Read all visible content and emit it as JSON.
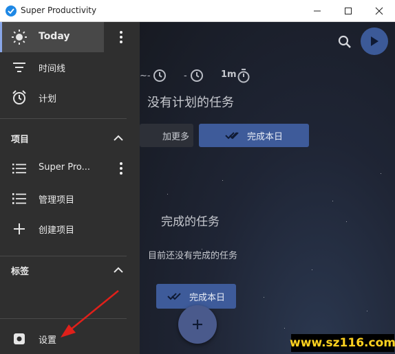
{
  "window": {
    "title": "Super Productivity"
  },
  "sidebar": {
    "today_label": "Today",
    "timeline_label": "时间线",
    "plan_label": "计划",
    "projects_header": "项目",
    "project_item_label": "Super Pro...",
    "manage_projects_label": "管理项目",
    "create_project_label": "创建项目",
    "tags_header": "标签",
    "settings_label": "设置"
  },
  "main": {
    "estimate_badge": "1m",
    "no_planned_tasks": "没有计划的任务",
    "add_more_label": "加更多",
    "finish_day_label": "完成本日",
    "done_tasks_title": "完成的任务",
    "no_done_tasks": "目前还没有完成的任务",
    "finish_day_label_2": "完成本日"
  },
  "watermark": {
    "text": "www.sz116.com"
  },
  "colors": {
    "accent": "#3e5b9a",
    "sidebar_bg": "#2f2f2f",
    "annotation_arrow": "#e0201a",
    "watermark_text": "#ffd21f"
  }
}
